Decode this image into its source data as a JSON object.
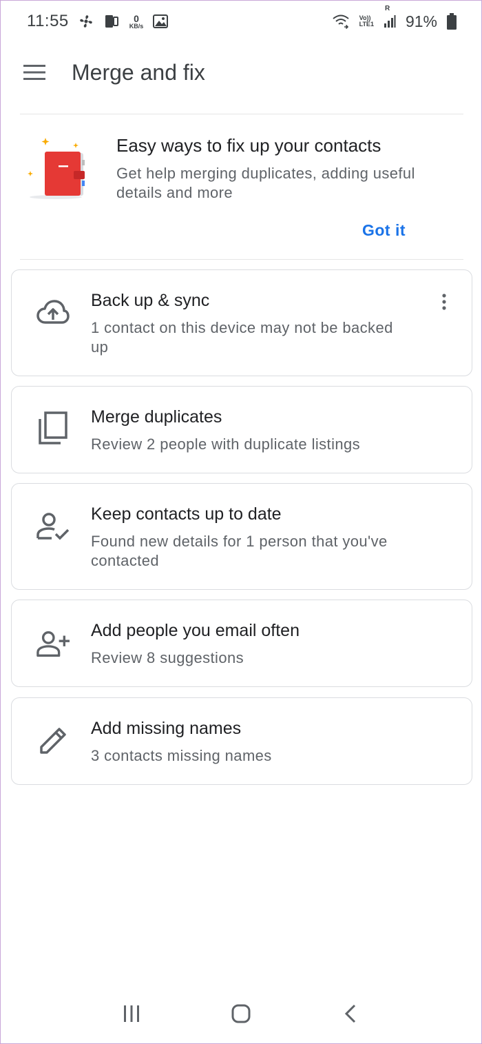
{
  "status_bar": {
    "time": "11:55",
    "speed_value": "0",
    "speed_unit": "KB/s",
    "volte_label": "Vo))",
    "lte_label": "LTE1",
    "roaming_label": "R",
    "battery_percent": "91%"
  },
  "app_bar": {
    "title": "Merge and fix"
  },
  "promo": {
    "title": "Easy ways to fix up your contacts",
    "description": "Get help merging duplicates, adding useful details and more",
    "action_label": "Got it"
  },
  "cards": [
    {
      "icon": "cloud-upload-icon",
      "title": "Back up & sync",
      "subtitle": "1 contact on this device may not be backed up"
    },
    {
      "icon": "copy-icon",
      "title": "Merge duplicates",
      "subtitle": "Review 2 people with duplicate listings"
    },
    {
      "icon": "person-check-icon",
      "title": "Keep contacts up to date",
      "subtitle": "Found new details for 1 person that you've contacted"
    },
    {
      "icon": "person-add-icon",
      "title": "Add people you email often",
      "subtitle": "Review 8 suggestions"
    },
    {
      "icon": "pencil-icon",
      "title": "Add missing names",
      "subtitle": "3 contacts missing names"
    }
  ],
  "colors": {
    "accent": "#1a73e8",
    "icon": "#5f6368",
    "promo_book": "#e53935",
    "sparkle": "#f9ab00"
  }
}
